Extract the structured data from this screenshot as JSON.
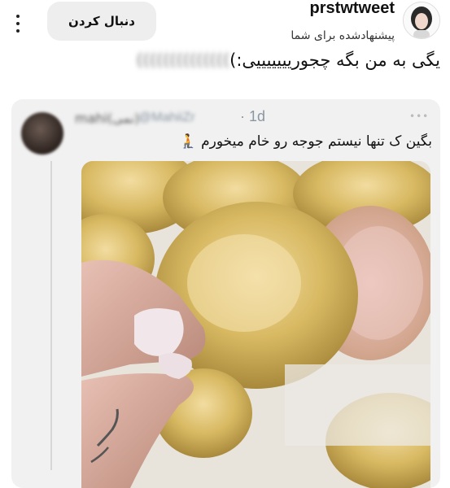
{
  "post": {
    "username": "prstwtweet",
    "suggested_label": "پیشنهادشده برای شما",
    "follow_label": "دنبال کردن",
    "caption_text": "یگی به من بگه چجوریییییییی:)",
    "caption_tail": "))))))))))))))"
  },
  "quoted": {
    "display_name": "mahi(نمی)",
    "handle": "@MahiiZr",
    "time": "· 1d",
    "more_icon": "•••",
    "text": "بگین ک تنها نیستم جوجه رو خام میخورم 🧎"
  },
  "icons": {
    "kebab": "more-vertical-icon",
    "more": "more-horizontal-icon"
  },
  "colors": {
    "card_bg": "#f1f1f1",
    "follow_bg": "#eeeeee",
    "meta_gray": "#8a96a3"
  }
}
